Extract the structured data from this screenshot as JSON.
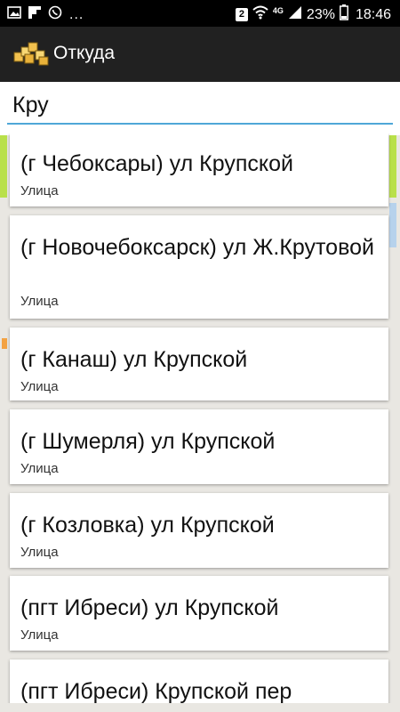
{
  "status_bar": {
    "dots": "...",
    "notification_count": "2",
    "network_type": "4G",
    "battery": "23%",
    "time": "18:46"
  },
  "app_bar": {
    "title": "Откуда"
  },
  "search": {
    "value": "Кру"
  },
  "suggestions": [
    {
      "title": "(г Чебоксары) ул Крупской",
      "type": "Улица"
    },
    {
      "title": "(г Новочебоксарск) ул Ж.Крутовой",
      "type": "Улица"
    },
    {
      "title": "(г Канаш) ул Крупской",
      "type": "Улица"
    },
    {
      "title": "(г Шумерля) ул Крупской",
      "type": "Улица"
    },
    {
      "title": "(г Козловка) ул Крупской",
      "type": "Улица"
    },
    {
      "title": "(пгт Ибреси) ул Крупской",
      "type": "Улица"
    },
    {
      "title": "(пгт Ибреси) Крупской пер",
      "type": ""
    }
  ]
}
